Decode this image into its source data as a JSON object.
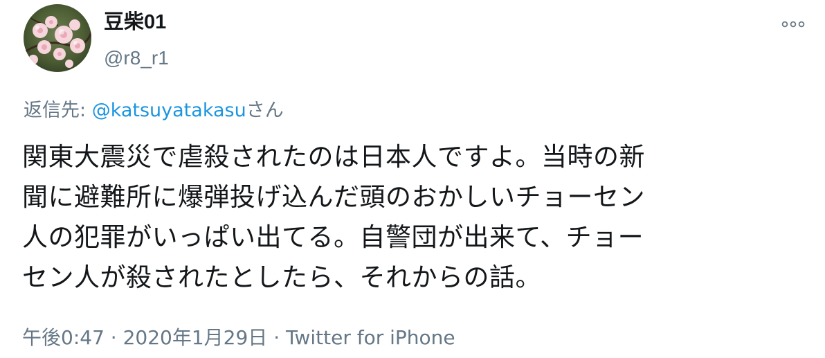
{
  "user": {
    "display_name": "豆柴01",
    "handle": "@r8_r1",
    "avatar": "cherry-blossom-photo"
  },
  "more_icon": "more-horizontal-icon",
  "reply": {
    "prefix": "返信先: ",
    "mention": "@katsuyatakasu",
    "suffix": "さん"
  },
  "tweet_text": "関東大震災で虐殺されたのは日本人ですよ。当時の新\n聞に避難所に爆弾投げ込んだ頭のおかしいチョーセン\n人の犯罪がいっぱい出てる。自警団が出来て、チョー\nセン人が殺されたとしたら、それからの話。",
  "meta": {
    "time": "午後0:47",
    "separator": " · ",
    "date": "2020年1月29日",
    "source": "Twitter for iPhone"
  },
  "colors": {
    "text": "#14171a",
    "secondary": "#657786",
    "link": "#1b95e0"
  }
}
